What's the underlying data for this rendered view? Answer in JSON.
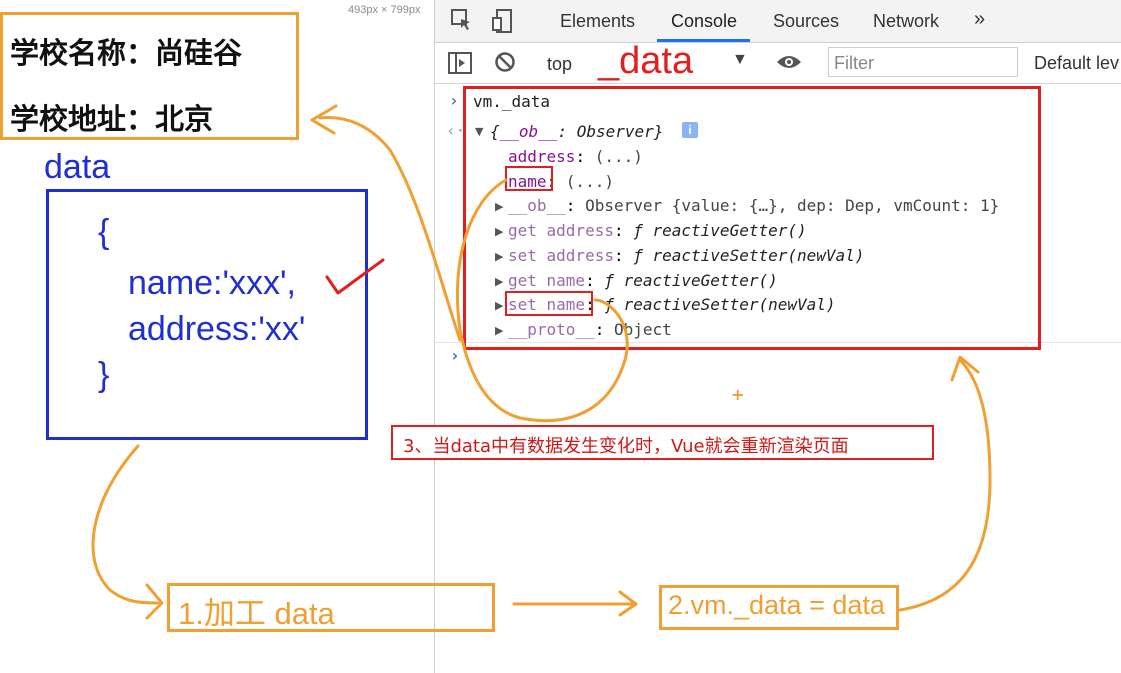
{
  "page": {
    "size_hint": "493px × 799px",
    "school_name_line": "学校名称：尚硅谷",
    "school_address_line": "学校地址：北京"
  },
  "data_diagram": {
    "title": "data",
    "lines": [
      "{",
      "name:'xxx',",
      "address:'xx'",
      "}"
    ]
  },
  "devtools": {
    "tabs": [
      "Elements",
      "Console",
      "Sources",
      "Network"
    ],
    "active_tab": "Console",
    "more_tabs": "»",
    "context": "top",
    "filter_placeholder": "Filter",
    "levels": "Default lev",
    "annotation": "_data",
    "accent": "#1a73e8"
  },
  "console": {
    "command": "vm._data",
    "object_header_prefix": "{",
    "object_header_key": "__ob__",
    "object_header_sep": ": ",
    "object_header_type": "Observer",
    "object_header_suffix": "}",
    "info_badge": "i",
    "rows": [
      {
        "key": "address",
        "sep": ": ",
        "value": "(...)"
      },
      {
        "key": "name",
        "sep": ": ",
        "value": "(...)"
      }
    ],
    "ob_row": {
      "key": "__ob__",
      "sep": ": ",
      "value": "Observer {value: {…}, dep: Dep, vmCount: 1}"
    },
    "accessor_rows": [
      {
        "key": "get address",
        "sep": ": ",
        "func": "ƒ reactiveGetter()"
      },
      {
        "key": "set address",
        "sep": ": ",
        "func": "ƒ reactiveSetter(newVal)"
      },
      {
        "key": "get name",
        "sep": ": ",
        "func": "ƒ reactiveGetter()"
      },
      {
        "key": "set name",
        "sep": ": ",
        "func": "ƒ reactiveSetter(newVal)"
      }
    ],
    "proto_row": {
      "key": "__proto__",
      "sep": ": ",
      "value": "Object"
    },
    "prompt_symbol": "›"
  },
  "annotations": {
    "caption": "3、当data中有数据发生变化时，Vue就会重新渲染页面",
    "step1": "1.加工 data",
    "step2": "2.vm._data = data",
    "colors": {
      "orange": "#f0a030",
      "red": "#e02020",
      "blue": "#1f2fd0"
    }
  }
}
